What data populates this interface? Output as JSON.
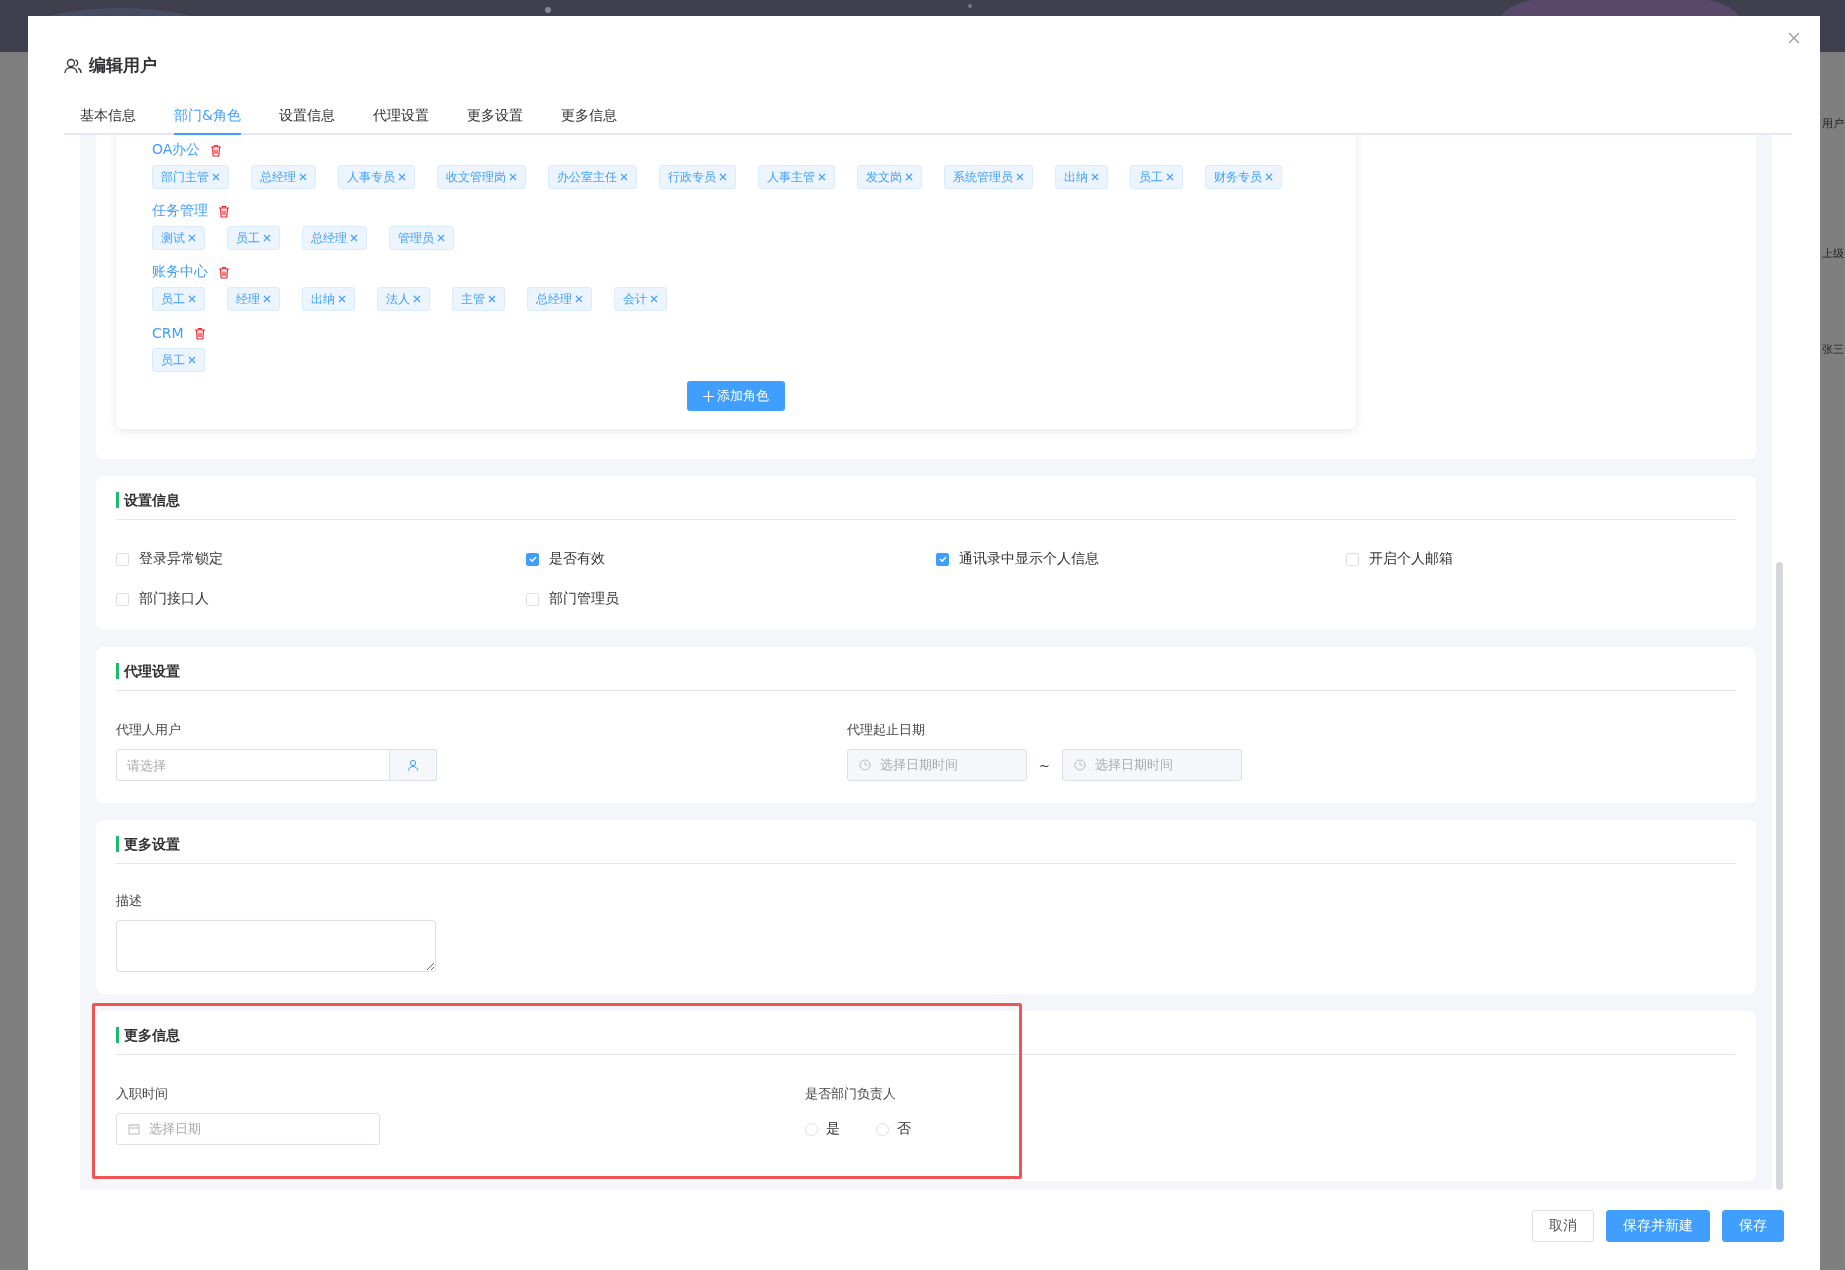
{
  "window_title": "编辑用户",
  "tabs": [
    {
      "label": "基本信息",
      "selected": false
    },
    {
      "label": "部门&角色",
      "selected": true
    },
    {
      "label": "设置信息",
      "selected": false
    },
    {
      "label": "代理设置",
      "selected": false
    },
    {
      "label": "更多设置",
      "selected": false
    },
    {
      "label": "更多信息",
      "selected": false
    }
  ],
  "role_groups": [
    {
      "name": "OA办公",
      "roles": [
        "部门主管",
        "总经理",
        "人事专员",
        "收文管理岗",
        "办公室主任",
        "行政专员",
        "人事主管",
        "发文岗",
        "系统管理员",
        "出纳",
        "员工",
        "财务专员"
      ]
    },
    {
      "name": "任务管理",
      "roles": [
        "测试",
        "员工",
        "总经理",
        "管理员"
      ]
    },
    {
      "name": "账务中心",
      "roles": [
        "员工",
        "经理",
        "出纳",
        "法人",
        "主管",
        "总经理",
        "会计"
      ]
    },
    {
      "name": "CRM",
      "roles": [
        "员工"
      ]
    }
  ],
  "add_role_button": "添加角色",
  "settings": {
    "title": "设置信息",
    "checkboxes": [
      {
        "label": "登录异常锁定",
        "checked": false
      },
      {
        "label": "是否有效",
        "checked": true
      },
      {
        "label": "通讯录中显示个人信息",
        "checked": true
      },
      {
        "label": "开启个人邮箱",
        "checked": false
      },
      {
        "label": "部门接口人",
        "checked": false
      },
      {
        "label": "部门管理员",
        "checked": false
      }
    ]
  },
  "agent": {
    "title": "代理设置",
    "user_label": "代理人用户",
    "user_placeholder": "请选择",
    "date_label": "代理起止日期",
    "start_placeholder": "选择日期时间",
    "separator": "~",
    "end_placeholder": "选择日期时间"
  },
  "more_settings": {
    "title": "更多设置",
    "description_label": "描述"
  },
  "more_info": {
    "title": "更多信息",
    "highlighted": true,
    "hire_date_label": "入职时间",
    "hire_date_placeholder": "选择日期",
    "leader_label": "是否部门负责人",
    "leader_options": [
      {
        "label": "是",
        "selected": false
      },
      {
        "label": "否",
        "selected": false
      }
    ]
  },
  "buttons": [
    {
      "label": "取消",
      "kind": "plain"
    },
    {
      "label": "保存并新建",
      "kind": "primary"
    },
    {
      "label": "保存",
      "kind": "primary"
    }
  ],
  "background_texts": [
    "用户",
    "上级",
    "张三"
  ]
}
